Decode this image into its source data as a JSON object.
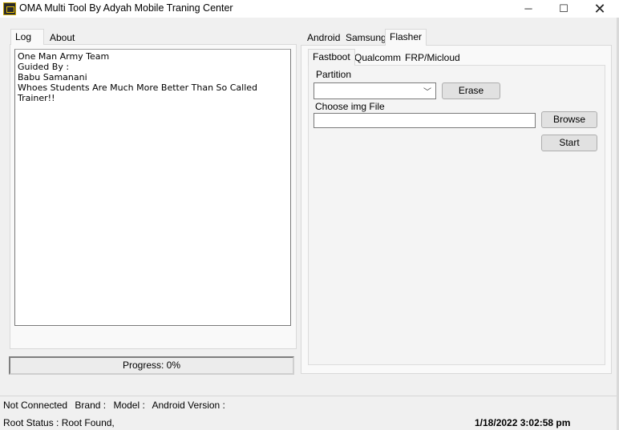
{
  "window": {
    "title": "OMA Multi Tool By Adyah Mobile Traning Center",
    "min_icon": "─",
    "max_icon": "☐",
    "close_icon": "✕"
  },
  "left_tabs": [
    "Log",
    "About"
  ],
  "log_lines": [
    "One Man Army Team",
    "Guided By :",
    "Babu Samanani",
    "Whoes Students Are Much More Better Than So Called Trainer!!"
  ],
  "progress": {
    "label": "Progress: 0%",
    "value": 0
  },
  "right_tabs": [
    "Android",
    "Samsung",
    "Flasher"
  ],
  "flasher_tabs": [
    "Fastboot",
    "Qualcomm",
    "FRP/Micloud"
  ],
  "fastboot": {
    "partition_label": "Partition",
    "partition_value": "",
    "dropdown_icon": "﹀",
    "erase_label": "Erase",
    "img_label": "Choose img File",
    "img_value": "",
    "browse_label": "Browse",
    "start_label": "Start"
  },
  "status": {
    "connection": "Not Connected",
    "brand": "Brand :",
    "model": "Model :",
    "android_version": "Android Version :",
    "root_status": "Root Status : Root Found,",
    "datetime": "1/18/2022 3:02:58 pm"
  }
}
